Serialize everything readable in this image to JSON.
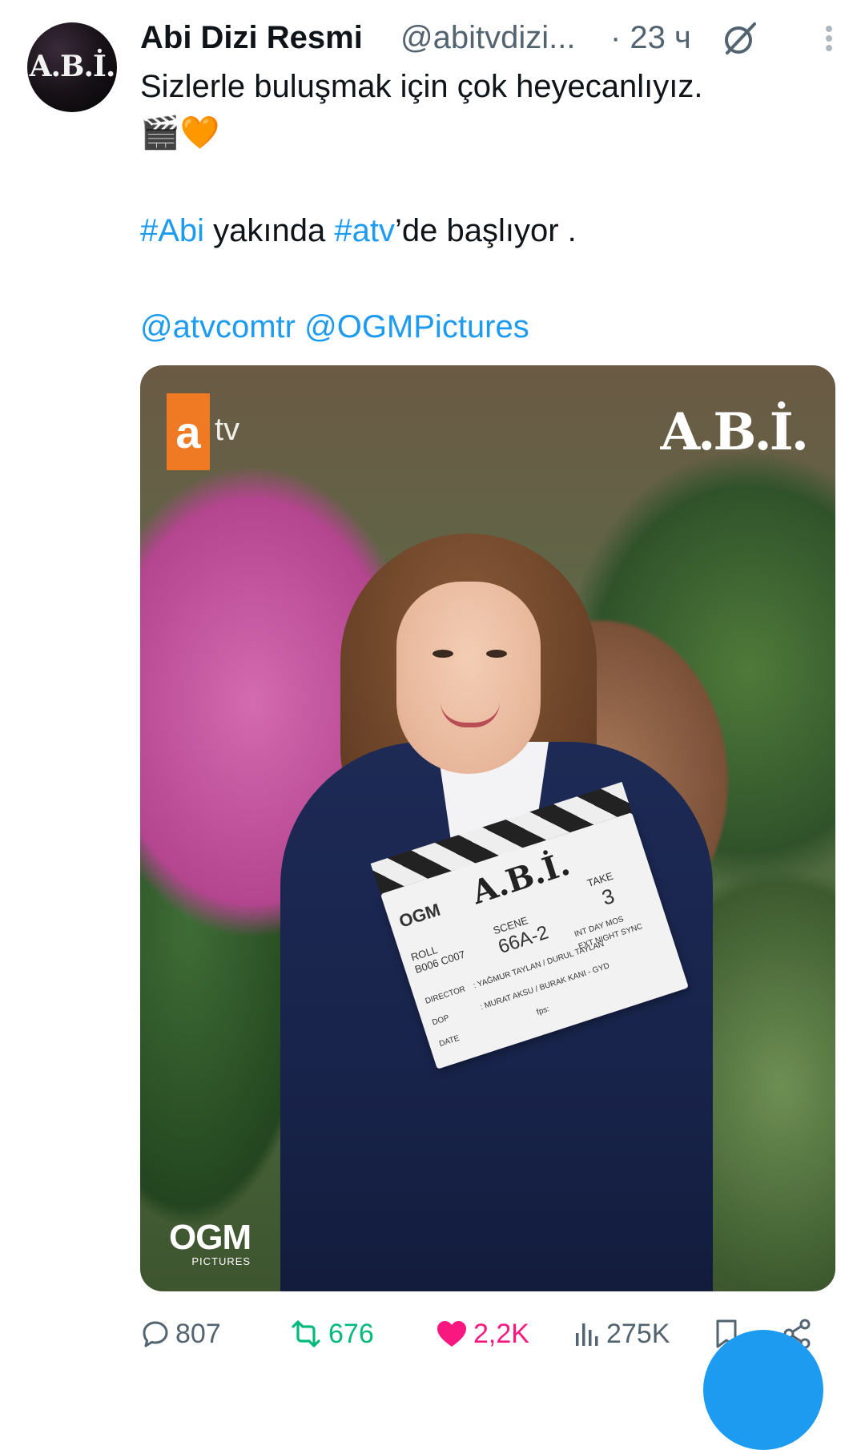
{
  "author": {
    "display_name": "Abi Dizi Resmi",
    "handle": "@abitvdizi...",
    "time": "· 23 ч",
    "avatar_logo": "A.B.İ."
  },
  "tweet": {
    "line1": "Sizlerle buluşmak için çok heyecanlıyız.",
    "emojis": "🎬🧡",
    "line2_parts": [
      "#Abi",
      " yakında ",
      "#atv",
      "’de başlıyor ."
    ],
    "mentions": [
      "@atvcomtr",
      "@OGMPictures"
    ]
  },
  "media": {
    "channel_logo": "a",
    "channel_logo_suffix": "tv",
    "show_logo": "A.B.İ.",
    "studio_logo": "OGM",
    "studio_logo_sub": "PICTURES",
    "clapper": {
      "title": "A.B.İ.",
      "studio": "OGM",
      "roll_label": "ROLL",
      "roll_value": "B006 C007",
      "scene_label": "SCENE",
      "scene_value": "66A-2",
      "take_label": "TAKE",
      "take_value": "3",
      "director_label": "DIRECTOR",
      "director_value": ": YAĞMUR TAYLAN / DURUL TAYLAN",
      "dop_label": "DOP",
      "dop_value": ": MURAT AKSU / BURAK KANI - GYD",
      "date_label": "DATE",
      "day_label": "INT DAY MOS",
      "ext_label": "EXT NIGHT SYNC",
      "fps_label": "fps:"
    }
  },
  "actions": {
    "replies": "807",
    "retweets": "676",
    "likes": "2,2K",
    "views": "275K"
  },
  "icons": [
    "grok-icon",
    "more-icon",
    "reply-icon",
    "retweet-icon",
    "heart-icon",
    "views-icon",
    "bookmark-icon",
    "share-icon"
  ],
  "colors": {
    "link": "#1d9bf0",
    "retweet": "#00ba7c",
    "like": "#f91880",
    "secondary": "#536471",
    "atv_orange": "#f07a24"
  }
}
